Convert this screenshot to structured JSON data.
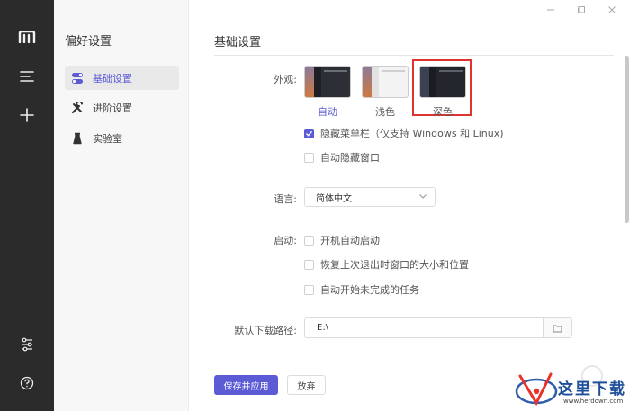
{
  "rail": {
    "icons": [
      "logo-icon",
      "menu-icon",
      "plus-icon",
      "settings-sliders-icon",
      "help-icon"
    ]
  },
  "sidebar": {
    "title": "偏好设置",
    "items": [
      {
        "label": "基础设置",
        "icon": "toggle-icon",
        "active": true
      },
      {
        "label": "进阶设置",
        "icon": "tools-icon",
        "active": false
      },
      {
        "label": "实验室",
        "icon": "flask-icon",
        "active": false
      }
    ]
  },
  "window": {
    "controls": [
      "minimize",
      "maximize",
      "close"
    ]
  },
  "page": {
    "title": "基础设置",
    "appearance": {
      "label": "外观:",
      "themes": [
        {
          "label": "自动",
          "selected": true
        },
        {
          "label": "浅色",
          "selected": false
        },
        {
          "label": "深色",
          "selected": false
        }
      ],
      "options": [
        {
          "label": "隐藏菜单栏（仅支持 Windows 和 Linux)",
          "checked": true
        },
        {
          "label": "自动隐藏窗口",
          "checked": false
        }
      ]
    },
    "language": {
      "label": "语言:",
      "value": "简体中文"
    },
    "startup": {
      "label": "启动:",
      "options": [
        {
          "label": "开机自动启动",
          "checked": false
        },
        {
          "label": "恢复上次退出时窗口的大小和位置",
          "checked": false
        },
        {
          "label": "自动开始未完成的任务",
          "checked": false
        }
      ]
    },
    "download": {
      "label": "默认下载路径:",
      "value": "E:\\"
    },
    "buttons": {
      "save": "保存并应用",
      "discard": "放弃"
    }
  },
  "watermark": {
    "title": "这里下载",
    "url": "www.herdown.com"
  },
  "colors": {
    "accent": "#5b5bd6",
    "highlight": "#e0322e",
    "rail": "#2b2b2b"
  }
}
